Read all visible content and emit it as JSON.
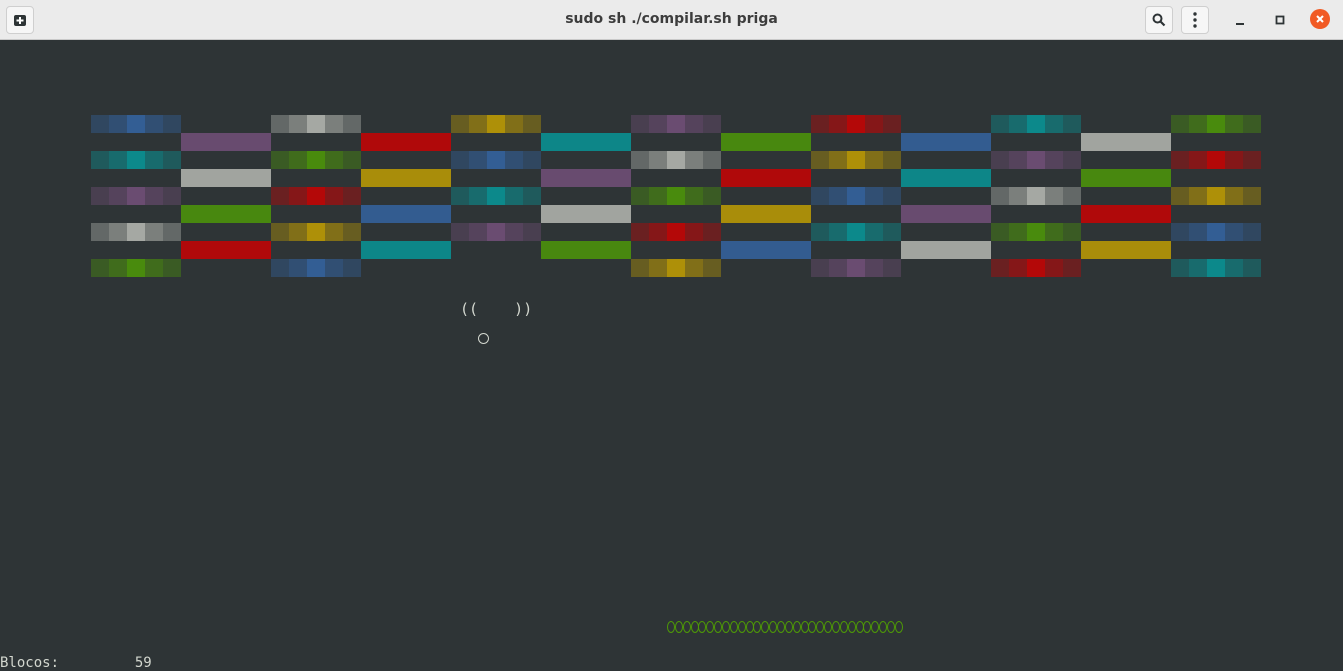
{
  "window": {
    "title": "sudo sh ./compilar.sh priga",
    "buttons": [
      "new-tab-icon",
      "search-icon",
      "menu-icon",
      "minimize-icon",
      "maximize-icon",
      "close-icon"
    ]
  },
  "palette": {
    "blue": "#3465a4",
    "purple": "#75507b",
    "gray": "#babdb6",
    "green": "#4e9a06",
    "red": "#cc0000",
    "yellow": "#c4a000",
    "cyan": "#06989a",
    "background": "#2e3436",
    "foreground": "#d3d7cf"
  },
  "game": {
    "brick_rows": [
      [
        "blue",
        "purple",
        "gray",
        "red",
        "yellow",
        "cyan",
        "purple",
        "green",
        "red",
        "blue",
        "cyan",
        "gray",
        "green"
      ],
      [
        "cyan",
        "gray",
        "green",
        "yellow",
        "blue",
        "purple",
        "gray",
        "red",
        "yellow",
        "cyan",
        "purple",
        "green",
        "red"
      ],
      [
        "purple",
        "green",
        "red",
        "blue",
        "cyan",
        "gray",
        "green",
        "yellow",
        "blue",
        "purple",
        "gray",
        "red",
        "yellow"
      ],
      [
        "gray",
        "red",
        "yellow",
        "cyan",
        "purple",
        "green",
        "red",
        "blue",
        "cyan",
        "gray",
        "green",
        "yellow",
        "blue"
      ],
      [
        "green",
        "",
        "blue",
        "",
        "",
        "",
        "yellow",
        "",
        "purple",
        "",
        "red",
        "",
        "cyan"
      ]
    ],
    "sprite_text": "((    ))",
    "paddle_segments": 30,
    "status_label": "Blocos:",
    "status_value": "59"
  }
}
